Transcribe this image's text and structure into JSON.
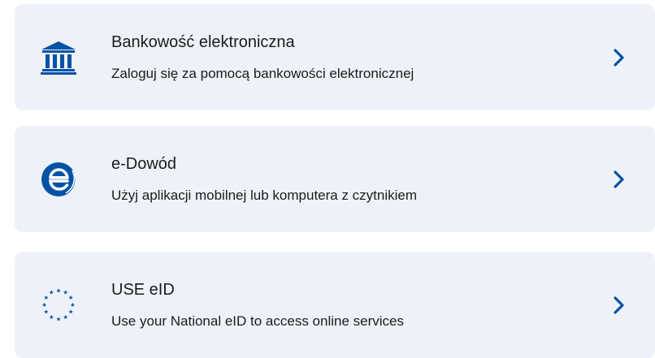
{
  "colors": {
    "card_background": "#eef2f8",
    "accent": "#0052a5",
    "text": "#1b1b1b"
  },
  "options": [
    {
      "title": "Bankowość elektroniczna",
      "subtitle": "Zaloguj się za pomocą bankowości elektronicznej",
      "icon": "bank-icon"
    },
    {
      "title": "e-Dowód",
      "subtitle": "Użyj aplikacji mobilnej lub komputera z czytnikiem",
      "icon": "e-id-card-icon"
    },
    {
      "title": "USE eID",
      "subtitle": "Use your National eID to access online services",
      "icon": "eu-stars-icon"
    }
  ]
}
